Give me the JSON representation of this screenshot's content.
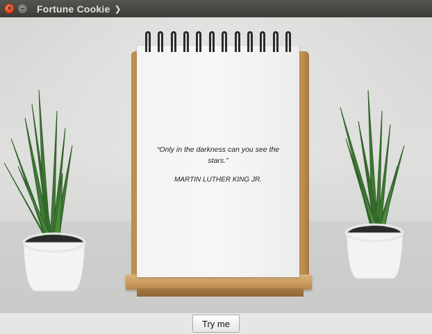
{
  "window": {
    "title": "Fortune Cookie",
    "close_glyph": "×",
    "minimize_glyph": "–",
    "menu_arrow_glyph": "❯"
  },
  "card": {
    "quote": "“Only in the darkness can you see the stars.”",
    "author": "MARTIN LUTHER KING JR."
  },
  "footer": {
    "button_label": "Try me"
  },
  "icons": {
    "close": "close-icon",
    "minimize": "minimize-icon",
    "menu_arrow": "chevron-right-icon"
  },
  "colors": {
    "titlebar": "#3c3b37",
    "close_button": "#e0461c",
    "wood": "#c89a58",
    "plant_leaf": "#2f6a2a",
    "pot": "#f4f4f4"
  },
  "ring_count": 12
}
